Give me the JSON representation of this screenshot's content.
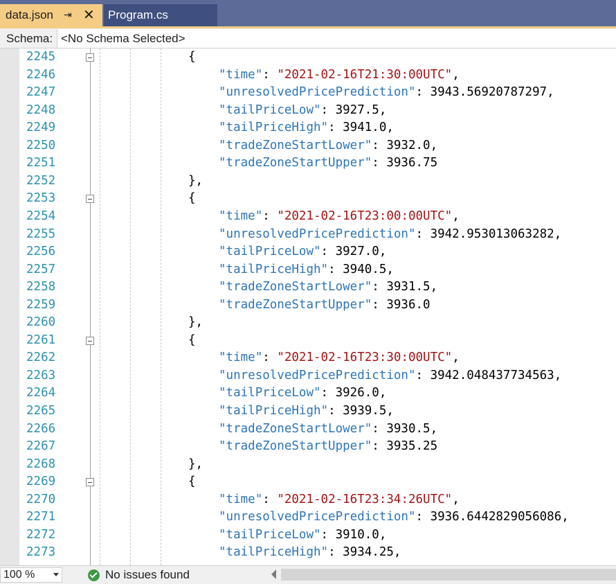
{
  "tabs": [
    {
      "label": "data.json",
      "active": true
    },
    {
      "label": "Program.cs",
      "active": false
    }
  ],
  "icons": {
    "pin": "pin-icon",
    "close": "close-icon",
    "fold": "collapse-icon",
    "status": "check-circle-icon"
  },
  "schema": {
    "label": "Schema:",
    "value": "<No Schema Selected>"
  },
  "lines": [
    {
      "n": "2245",
      "text": "{"
    },
    {
      "n": "2246",
      "key": "time",
      "value": "\"2021-02-16T21:30:00UTC\"",
      "type": "string",
      "comma": true
    },
    {
      "n": "2247",
      "key": "unresolvedPricePrediction",
      "value": "3943.56920787297",
      "type": "number",
      "comma": true
    },
    {
      "n": "2248",
      "key": "tailPriceLow",
      "value": "3927.5",
      "type": "number",
      "comma": true
    },
    {
      "n": "2249",
      "key": "tailPriceHigh",
      "value": "3941.0",
      "type": "number",
      "comma": true
    },
    {
      "n": "2250",
      "key": "tradeZoneStartLower",
      "value": "3932.0",
      "type": "number",
      "comma": true
    },
    {
      "n": "2251",
      "key": "tradeZoneStartUpper",
      "value": "3936.75",
      "type": "number",
      "comma": false
    },
    {
      "n": "2252",
      "text": "},"
    },
    {
      "n": "2253",
      "text": "{"
    },
    {
      "n": "2254",
      "key": "time",
      "value": "\"2021-02-16T23:00:00UTC\"",
      "type": "string",
      "comma": true
    },
    {
      "n": "2255",
      "key": "unresolvedPricePrediction",
      "value": "3942.953013063282",
      "type": "number",
      "comma": true
    },
    {
      "n": "2256",
      "key": "tailPriceLow",
      "value": "3927.0",
      "type": "number",
      "comma": true
    },
    {
      "n": "2257",
      "key": "tailPriceHigh",
      "value": "3940.5",
      "type": "number",
      "comma": true
    },
    {
      "n": "2258",
      "key": "tradeZoneStartLower",
      "value": "3931.5",
      "type": "number",
      "comma": true
    },
    {
      "n": "2259",
      "key": "tradeZoneStartUpper",
      "value": "3936.0",
      "type": "number",
      "comma": false
    },
    {
      "n": "2260",
      "text": "},"
    },
    {
      "n": "2261",
      "text": "{"
    },
    {
      "n": "2262",
      "key": "time",
      "value": "\"2021-02-16T23:30:00UTC\"",
      "type": "string",
      "comma": true
    },
    {
      "n": "2263",
      "key": "unresolvedPricePrediction",
      "value": "3942.048437734563",
      "type": "number",
      "comma": true
    },
    {
      "n": "2264",
      "key": "tailPriceLow",
      "value": "3926.0",
      "type": "number",
      "comma": true
    },
    {
      "n": "2265",
      "key": "tailPriceHigh",
      "value": "3939.5",
      "type": "number",
      "comma": true
    },
    {
      "n": "2266",
      "key": "tradeZoneStartLower",
      "value": "3930.5",
      "type": "number",
      "comma": true
    },
    {
      "n": "2267",
      "key": "tradeZoneStartUpper",
      "value": "3935.25",
      "type": "number",
      "comma": false
    },
    {
      "n": "2268",
      "text": "},"
    },
    {
      "n": "2269",
      "text": "{"
    },
    {
      "n": "2270",
      "key": "time",
      "value": "\"2021-02-16T23:34:26UTC\"",
      "type": "string",
      "comma": true
    },
    {
      "n": "2271",
      "key": "unresolvedPricePrediction",
      "value": "3936.6442829056086",
      "type": "number",
      "comma": true
    },
    {
      "n": "2272",
      "key": "tailPriceLow",
      "value": "3910.0",
      "type": "number",
      "comma": true
    },
    {
      "n": "2273",
      "key": "tailPriceHigh",
      "value": "3934.25",
      "type": "number",
      "comma": true
    }
  ],
  "status": {
    "zoom": "100 %",
    "issues": "No issues found"
  }
}
